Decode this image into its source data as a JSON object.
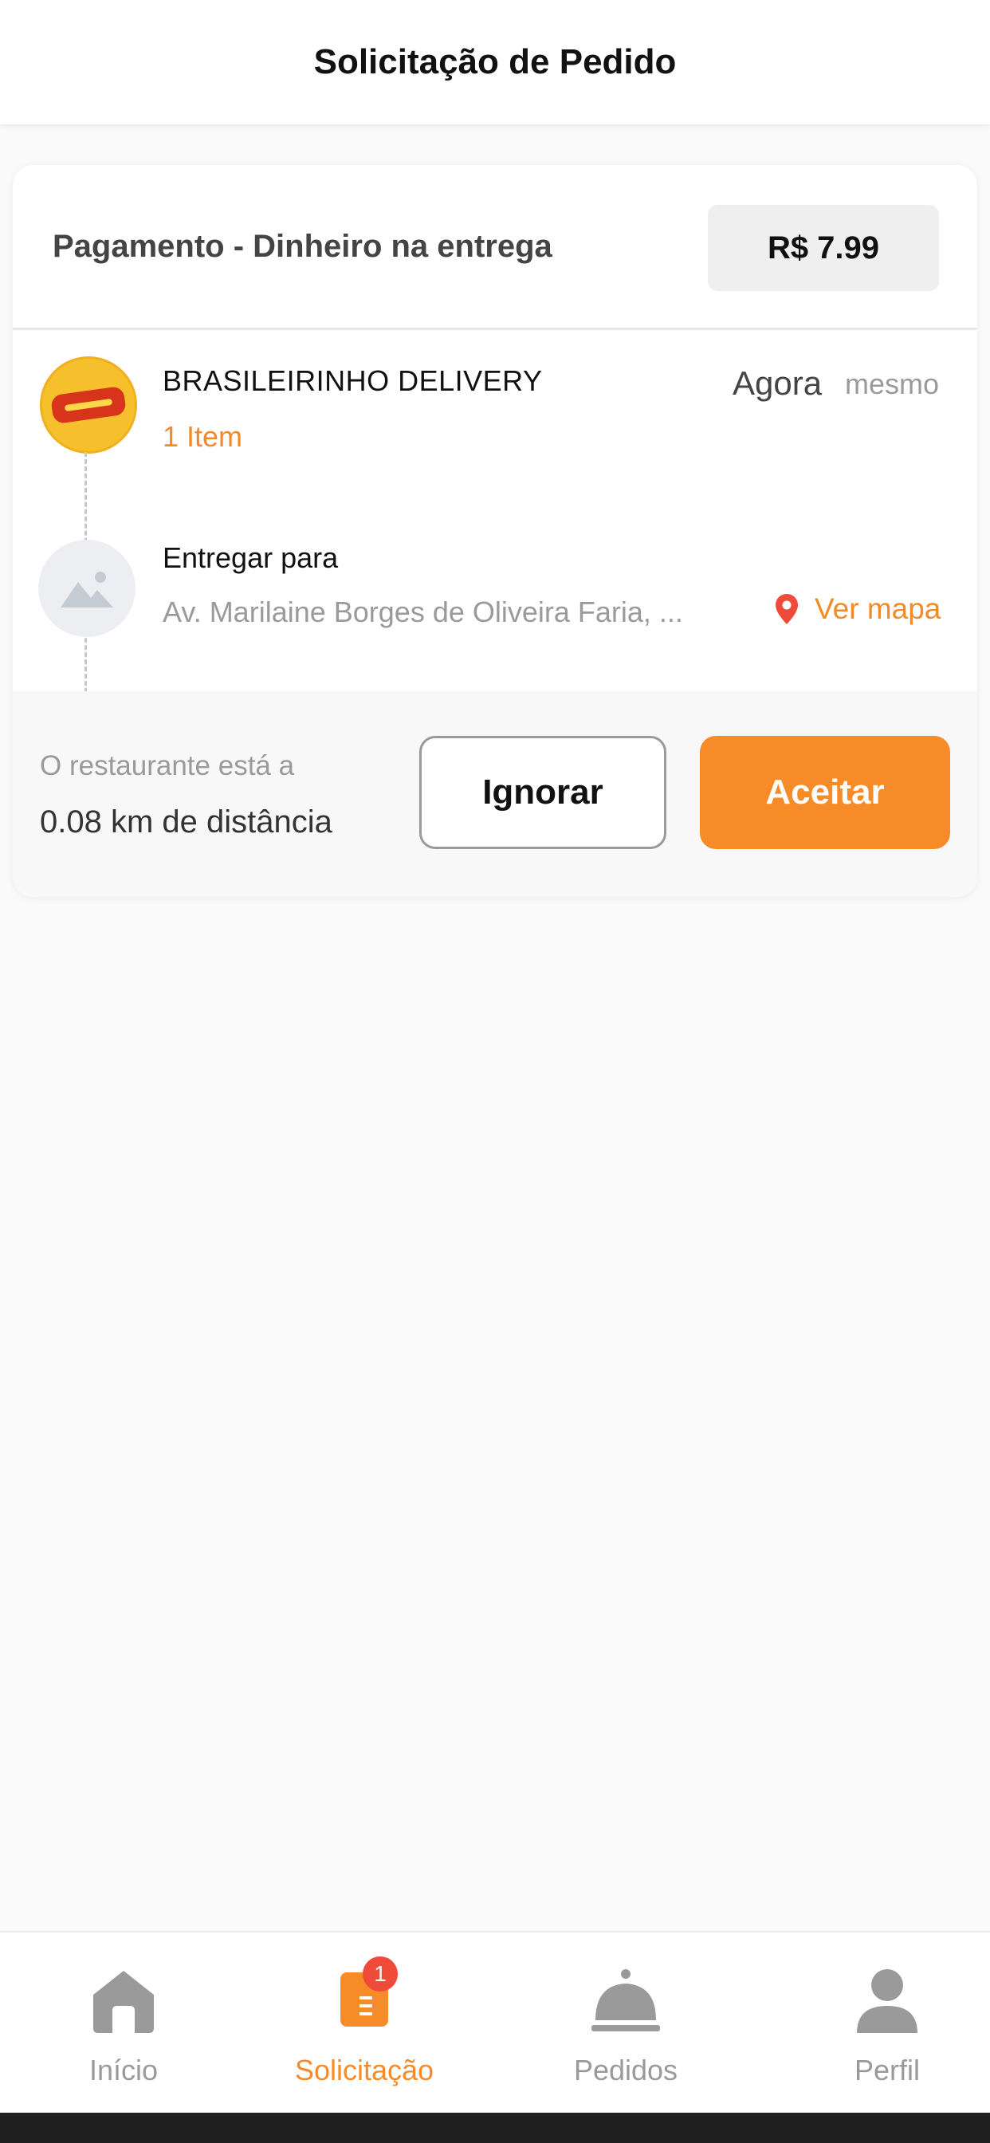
{
  "header": {
    "title": "Solicitação de Pedido"
  },
  "order": {
    "payment_label": "Pagamento - Dinheiro na entrega",
    "price": "R$ 7.99",
    "restaurant": {
      "name": "BRASILEIRINHO DELIVERY",
      "items": "1 Item",
      "time_main": "Agora",
      "time_sub": "mesmo"
    },
    "delivery": {
      "label": "Entregar para",
      "address": "Av. Marilaine Borges de Oliveira Faria, ...",
      "map_link": "Ver mapa"
    },
    "distance": {
      "line1": "O restaurante está a",
      "line2": "0.08 km de distância"
    },
    "buttons": {
      "ignore": "Ignorar",
      "accept": "Aceitar"
    }
  },
  "colors": {
    "accent": "#f68b28",
    "badge": "#f04a3a",
    "inactive": "#9a9a9a",
    "logo_background": "#f5c02b"
  },
  "nav": {
    "items": [
      {
        "label": "Início",
        "icon": "home-icon",
        "active": false
      },
      {
        "label": "Solicitação",
        "icon": "request-icon",
        "active": true,
        "badge": "1"
      },
      {
        "label": "Pedidos",
        "icon": "cloche-icon",
        "active": false
      },
      {
        "label": "Perfil",
        "icon": "user-icon",
        "active": false
      }
    ]
  }
}
